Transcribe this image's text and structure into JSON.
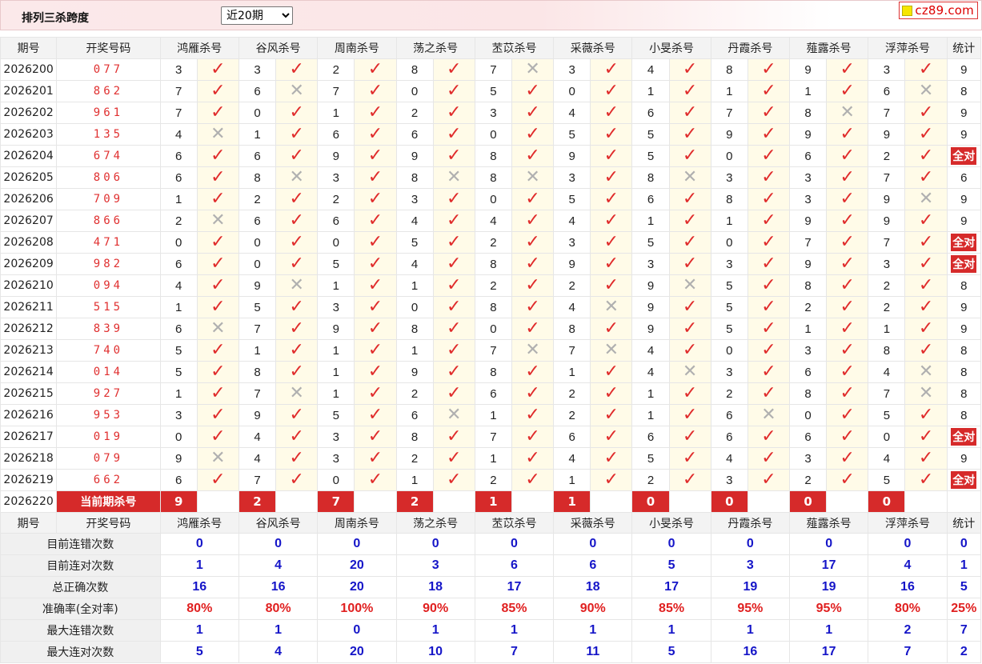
{
  "header": {
    "title": "排列三杀跨度",
    "period_select": {
      "value": "近20期",
      "options": [
        "近20期"
      ]
    },
    "brand": "cz89.com"
  },
  "columns": {
    "period": "期号",
    "draw": "开奖号码",
    "experts": [
      "鸿雁杀号",
      "谷风杀号",
      "周南杀号",
      "荡之杀号",
      "苤苡杀号",
      "采薇杀号",
      "小旻杀号",
      "丹霞杀号",
      "薤露杀号",
      "浮萍杀号"
    ],
    "stats": "统计"
  },
  "rows": [
    {
      "period": "2026200",
      "draw": "077",
      "kills": [
        3,
        3,
        2,
        8,
        7,
        3,
        4,
        8,
        9,
        3
      ],
      "hits": [
        1,
        1,
        1,
        1,
        0,
        1,
        1,
        1,
        1,
        1
      ],
      "stat": "9"
    },
    {
      "period": "2026201",
      "draw": "862",
      "kills": [
        7,
        6,
        7,
        0,
        5,
        0,
        1,
        1,
        1,
        6
      ],
      "hits": [
        1,
        0,
        1,
        1,
        1,
        1,
        1,
        1,
        1,
        0
      ],
      "stat": "8"
    },
    {
      "period": "2026202",
      "draw": "961",
      "kills": [
        7,
        0,
        1,
        2,
        3,
        4,
        6,
        7,
        8,
        7
      ],
      "hits": [
        1,
        1,
        1,
        1,
        1,
        1,
        1,
        1,
        0,
        1
      ],
      "stat": "9"
    },
    {
      "period": "2026203",
      "draw": "135",
      "kills": [
        4,
        1,
        6,
        6,
        0,
        5,
        5,
        9,
        9,
        9
      ],
      "hits": [
        0,
        1,
        1,
        1,
        1,
        1,
        1,
        1,
        1,
        1
      ],
      "stat": "9"
    },
    {
      "period": "2026204",
      "draw": "674",
      "kills": [
        6,
        6,
        9,
        9,
        8,
        9,
        5,
        0,
        6,
        2
      ],
      "hits": [
        1,
        1,
        1,
        1,
        1,
        1,
        1,
        1,
        1,
        1
      ],
      "stat": "全对"
    },
    {
      "period": "2026205",
      "draw": "806",
      "kills": [
        6,
        8,
        3,
        8,
        8,
        3,
        8,
        3,
        3,
        7
      ],
      "hits": [
        1,
        0,
        1,
        0,
        0,
        1,
        0,
        1,
        1,
        1
      ],
      "stat": "6"
    },
    {
      "period": "2026206",
      "draw": "709",
      "kills": [
        1,
        2,
        2,
        3,
        0,
        5,
        6,
        8,
        3,
        9
      ],
      "hits": [
        1,
        1,
        1,
        1,
        1,
        1,
        1,
        1,
        1,
        0
      ],
      "stat": "9"
    },
    {
      "period": "2026207",
      "draw": "866",
      "kills": [
        2,
        6,
        6,
        4,
        4,
        4,
        1,
        1,
        9,
        9
      ],
      "hits": [
        0,
        1,
        1,
        1,
        1,
        1,
        1,
        1,
        1,
        1
      ],
      "stat": "9"
    },
    {
      "period": "2026208",
      "draw": "471",
      "kills": [
        0,
        0,
        0,
        5,
        2,
        3,
        5,
        0,
        7,
        7
      ],
      "hits": [
        1,
        1,
        1,
        1,
        1,
        1,
        1,
        1,
        1,
        1
      ],
      "stat": "全对"
    },
    {
      "period": "2026209",
      "draw": "982",
      "kills": [
        6,
        0,
        5,
        4,
        8,
        9,
        3,
        3,
        9,
        3
      ],
      "hits": [
        1,
        1,
        1,
        1,
        1,
        1,
        1,
        1,
        1,
        1
      ],
      "stat": "全对"
    },
    {
      "period": "2026210",
      "draw": "094",
      "kills": [
        4,
        9,
        1,
        1,
        2,
        2,
        9,
        5,
        8,
        2
      ],
      "hits": [
        1,
        0,
        1,
        1,
        1,
        1,
        0,
        1,
        1,
        1
      ],
      "stat": "8"
    },
    {
      "period": "2026211",
      "draw": "515",
      "kills": [
        1,
        5,
        3,
        0,
        8,
        4,
        9,
        5,
        2,
        2
      ],
      "hits": [
        1,
        1,
        1,
        1,
        1,
        0,
        1,
        1,
        1,
        1
      ],
      "stat": "9"
    },
    {
      "period": "2026212",
      "draw": "839",
      "kills": [
        6,
        7,
        9,
        8,
        0,
        8,
        9,
        5,
        1,
        1
      ],
      "hits": [
        0,
        1,
        1,
        1,
        1,
        1,
        1,
        1,
        1,
        1
      ],
      "stat": "9"
    },
    {
      "period": "2026213",
      "draw": "740",
      "kills": [
        5,
        1,
        1,
        1,
        7,
        7,
        4,
        0,
        3,
        8
      ],
      "hits": [
        1,
        1,
        1,
        1,
        0,
        0,
        1,
        1,
        1,
        1
      ],
      "stat": "8"
    },
    {
      "period": "2026214",
      "draw": "014",
      "kills": [
        5,
        8,
        1,
        9,
        8,
        1,
        4,
        3,
        6,
        4
      ],
      "hits": [
        1,
        1,
        1,
        1,
        1,
        1,
        0,
        1,
        1,
        0
      ],
      "stat": "8"
    },
    {
      "period": "2026215",
      "draw": "927",
      "kills": [
        1,
        7,
        1,
        2,
        6,
        2,
        1,
        2,
        8,
        7
      ],
      "hits": [
        1,
        0,
        1,
        1,
        1,
        1,
        1,
        1,
        1,
        0
      ],
      "stat": "8"
    },
    {
      "period": "2026216",
      "draw": "953",
      "kills": [
        3,
        9,
        5,
        6,
        1,
        2,
        1,
        6,
        0,
        5
      ],
      "hits": [
        1,
        1,
        1,
        0,
        1,
        1,
        1,
        0,
        1,
        1
      ],
      "stat": "8"
    },
    {
      "period": "2026217",
      "draw": "019",
      "kills": [
        0,
        4,
        3,
        8,
        7,
        6,
        6,
        6,
        6,
        0
      ],
      "hits": [
        1,
        1,
        1,
        1,
        1,
        1,
        1,
        1,
        1,
        1
      ],
      "stat": "全对"
    },
    {
      "period": "2026218",
      "draw": "079",
      "kills": [
        9,
        4,
        3,
        2,
        1,
        4,
        5,
        4,
        3,
        4
      ],
      "hits": [
        0,
        1,
        1,
        1,
        1,
        1,
        1,
        1,
        1,
        1
      ],
      "stat": "9"
    },
    {
      "period": "2026219",
      "draw": "662",
      "kills": [
        6,
        7,
        0,
        1,
        2,
        1,
        2,
        3,
        2,
        5
      ],
      "hits": [
        1,
        1,
        1,
        1,
        1,
        1,
        1,
        1,
        1,
        1
      ],
      "stat": "全对"
    }
  ],
  "current": {
    "period": "2026220",
    "label": "当前期杀号",
    "kills": [
      "9",
      "2",
      "7",
      "2",
      "1",
      "1",
      "0",
      "0",
      "0",
      "0"
    ]
  },
  "summary": [
    {
      "label": "目前连错次数",
      "values": [
        "0",
        "0",
        "0",
        "0",
        "0",
        "0",
        "0",
        "0",
        "0",
        "0"
      ],
      "stat": "0"
    },
    {
      "label": "目前连对次数",
      "values": [
        "1",
        "4",
        "20",
        "3",
        "6",
        "6",
        "5",
        "3",
        "17",
        "4"
      ],
      "stat": "1"
    },
    {
      "label": "总正确次数",
      "values": [
        "16",
        "16",
        "20",
        "18",
        "17",
        "18",
        "17",
        "19",
        "19",
        "16"
      ],
      "stat": "5"
    },
    {
      "label": "准确率(全对率)",
      "values": [
        "80%",
        "80%",
        "100%",
        "90%",
        "85%",
        "90%",
        "85%",
        "95%",
        "95%",
        "80%"
      ],
      "stat": "25%",
      "pct": true
    },
    {
      "label": "最大连错次数",
      "values": [
        "1",
        "1",
        "0",
        "1",
        "1",
        "1",
        "1",
        "1",
        "1",
        "2"
      ],
      "stat": "7"
    },
    {
      "label": "最大连对次数",
      "values": [
        "5",
        "4",
        "20",
        "10",
        "7",
        "11",
        "5",
        "16",
        "17",
        "7"
      ],
      "stat": "2"
    }
  ],
  "icons": {
    "hit": "checkmark-icon",
    "miss": "cross-icon"
  },
  "colors": {
    "hit": "#e02b2b",
    "miss": "#b0b0b0",
    "accent": "#d62a2a",
    "metric": "#1515c8"
  }
}
